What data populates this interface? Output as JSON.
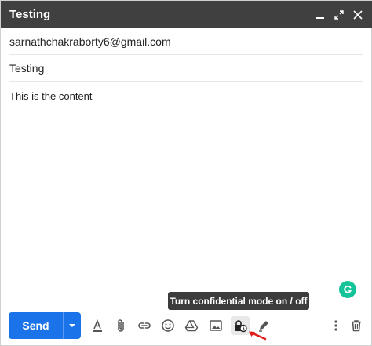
{
  "window": {
    "title": "Testing"
  },
  "fields": {
    "to": "sarnathchakraborty6@gmail.com",
    "subject": "Testing"
  },
  "message": {
    "body": "This is the content"
  },
  "toolbar": {
    "send_label": "Send",
    "tooltip": "Turn confidential mode on / off",
    "icons": [
      "formatting-icon",
      "attach-icon",
      "link-icon",
      "emoji-icon",
      "drive-icon",
      "photo-icon",
      "confidential-mode-icon",
      "signature-icon",
      "more-options-icon",
      "discard-icon"
    ]
  },
  "colors": {
    "header_bg": "#404040",
    "send_blue": "#1a73e8",
    "tooltip_bg": "#3c3c3c",
    "grammarly_green": "#15c39a",
    "arrow_red": "#e01b1b"
  }
}
